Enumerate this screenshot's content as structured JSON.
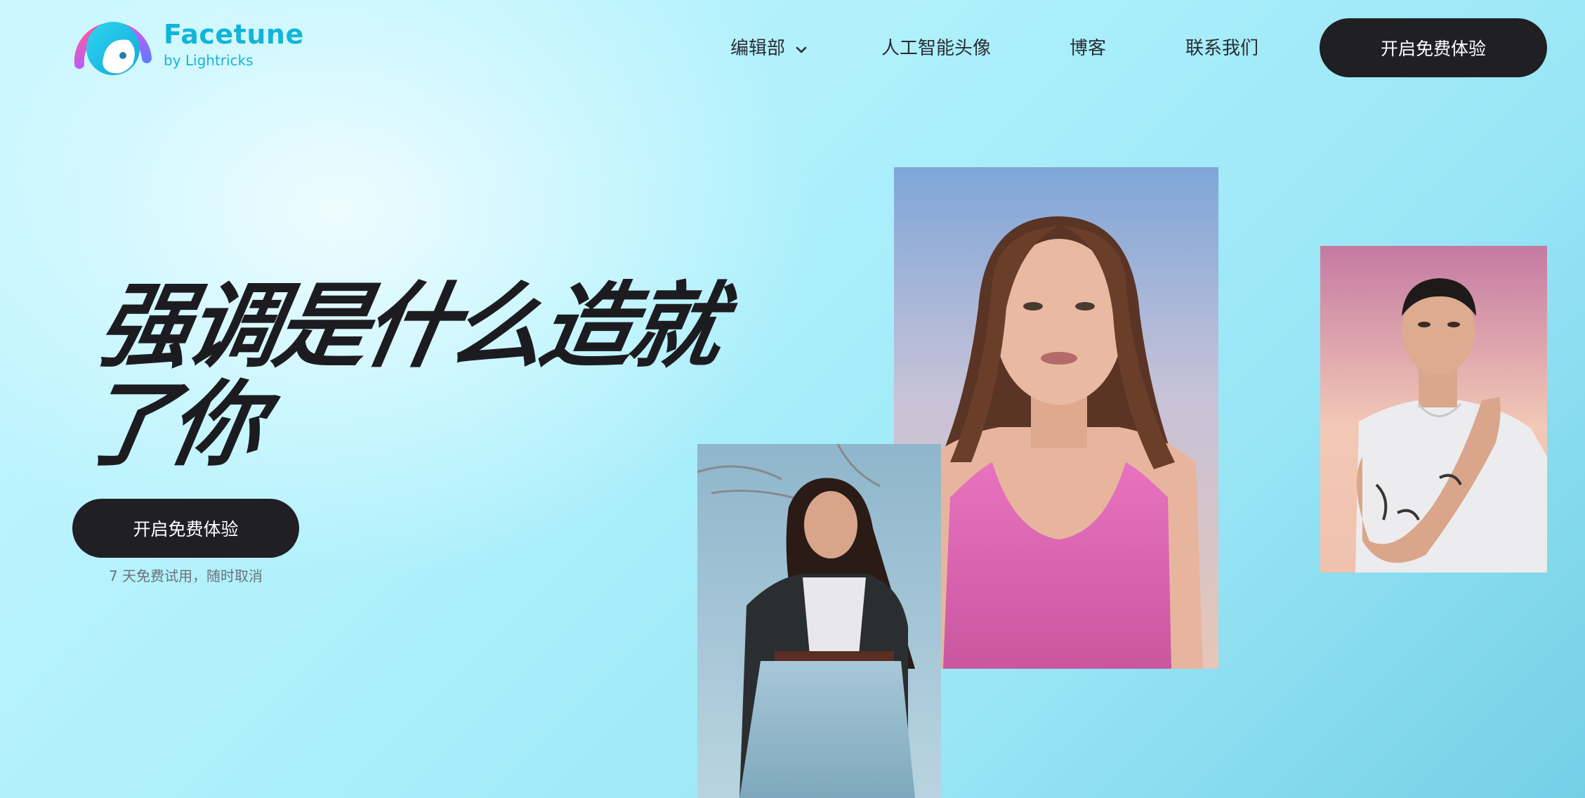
{
  "brand": {
    "name": "Facetune",
    "tagline": "by Lightricks",
    "icon": "facetune-logo-icon"
  },
  "nav": {
    "items": [
      {
        "label": "编辑部",
        "has_dropdown": true
      },
      {
        "label": "人工智能头像"
      },
      {
        "label": "博客"
      },
      {
        "label": "联系我们"
      }
    ],
    "cta_label": "开启免费体验"
  },
  "hero": {
    "title_line1": "强调是什么造就",
    "title_line2": "了你",
    "cta_label": "开启免费体验",
    "trial_note": "7 天免费试用，随时取消"
  },
  "images": {
    "center": "portrait-woman-pink-top",
    "left": "portrait-woman-leather-jacket",
    "right": "portrait-man-white-tshirt-tattoos"
  },
  "colors": {
    "brand_cyan": "#12b5d8",
    "button_dark": "#1f1f24",
    "background_light": "#c8f6ff",
    "background_deep": "#74cfe6",
    "title_dark": "#1c1c20"
  }
}
